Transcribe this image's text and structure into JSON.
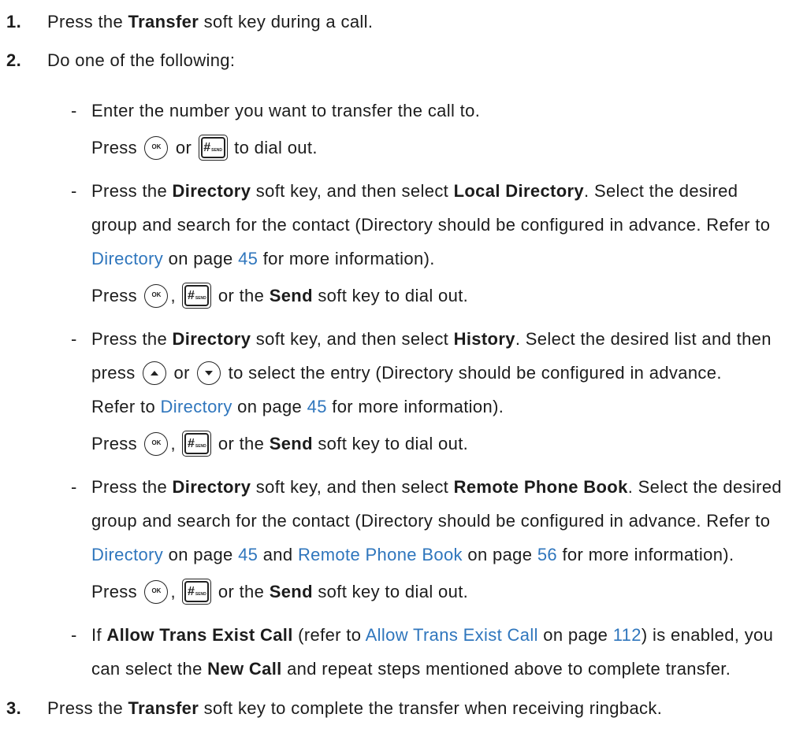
{
  "colors": {
    "text": "#1c1c1c",
    "link": "#2f76bd"
  },
  "keys": {
    "ok": "OK",
    "hash": "#",
    "send": "SEND"
  },
  "steps": [
    {
      "number": "1.",
      "lines": [
        [
          {
            "text": "Press the "
          },
          {
            "bold": "Transfer"
          },
          {
            "text": " soft key during a call."
          }
        ]
      ]
    },
    {
      "number": "2.",
      "lines": [
        [
          {
            "text": "Do one of the following:"
          }
        ]
      ],
      "options": [
        {
          "bullet": "-",
          "lines": [
            [
              {
                "text": "Enter the number you want to transfer the call to."
              }
            ]
          ],
          "press": [
            {
              "text": "Press "
            },
            {
              "key": "ok-key"
            },
            {
              "text": " or "
            },
            {
              "key": "send-key"
            },
            {
              "text": " to dial out."
            }
          ]
        },
        {
          "bullet": "-",
          "lines": [
            [
              {
                "text": "Press the "
              },
              {
                "bold": "Directory"
              },
              {
                "text": " soft key, and then select "
              },
              {
                "bold": "Local Directory"
              },
              {
                "text": ". Select the desired"
              }
            ],
            [
              {
                "text": "group and search for the contact (Directory should be configured in advance. Refer to"
              }
            ],
            [
              {
                "link": "Directory"
              },
              {
                "text": " on page "
              },
              {
                "link": "45"
              },
              {
                "text": " for more information)."
              }
            ]
          ],
          "press": [
            {
              "text": "Press "
            },
            {
              "key": "ok-key"
            },
            {
              "text": ", "
            },
            {
              "key": "send-key"
            },
            {
              "text": " or the "
            },
            {
              "bold": "Send"
            },
            {
              "text": " soft key to dial out."
            }
          ]
        },
        {
          "bullet": "-",
          "lines": [
            [
              {
                "text": "Press the "
              },
              {
                "bold": "Directory"
              },
              {
                "text": " soft key, and then select "
              },
              {
                "bold": "History"
              },
              {
                "text": ". Select the desired list and then"
              }
            ],
            [
              {
                "text": "press "
              },
              {
                "key": "up-key"
              },
              {
                "text": " or "
              },
              {
                "key": "down-key"
              },
              {
                "text": " to select the entry (Directory should be configured in advance."
              }
            ],
            [
              {
                "text": "Refer to "
              },
              {
                "link": "Directory"
              },
              {
                "text": " on page "
              },
              {
                "link": "45"
              },
              {
                "text": " for more information)."
              }
            ]
          ],
          "press": [
            {
              "text": "Press "
            },
            {
              "key": "ok-key"
            },
            {
              "text": ", "
            },
            {
              "key": "send-key"
            },
            {
              "text": " or the "
            },
            {
              "bold": "Send"
            },
            {
              "text": " soft key to dial out."
            }
          ]
        },
        {
          "bullet": "-",
          "lines": [
            [
              {
                "text": "Press the "
              },
              {
                "bold": "Directory"
              },
              {
                "text": " soft key, and then select "
              },
              {
                "bold": "Remote Phone Book"
              },
              {
                "text": ". Select the desired"
              }
            ],
            [
              {
                "text": "group and search for the contact (Directory should be configured in advance. Refer to"
              }
            ],
            [
              {
                "link": "Directory"
              },
              {
                "text": " on page "
              },
              {
                "link": "45"
              },
              {
                "text": " and "
              },
              {
                "link": "Remote Phone Book"
              },
              {
                "text": " on page "
              },
              {
                "link": "56"
              },
              {
                "text": " for more information)."
              }
            ]
          ],
          "press": [
            {
              "text": "Press "
            },
            {
              "key": "ok-key"
            },
            {
              "text": ", "
            },
            {
              "key": "send-key"
            },
            {
              "text": " or the "
            },
            {
              "bold": "Send"
            },
            {
              "text": " soft key to dial out."
            }
          ]
        },
        {
          "bullet": "-",
          "lines": [
            [
              {
                "text": "If "
              },
              {
                "bold": "Allow Trans Exist Call"
              },
              {
                "text": " (refer to "
              },
              {
                "link": "Allow Trans Exist Call"
              },
              {
                "text": " on page "
              },
              {
                "link": "112"
              },
              {
                "text": ") is enabled, you"
              }
            ],
            [
              {
                "text": "can select the "
              },
              {
                "bold": "New Call"
              },
              {
                "text": " and repeat steps mentioned above to complete transfer."
              }
            ]
          ]
        }
      ]
    },
    {
      "number": "3.",
      "lines": [
        [
          {
            "text": "Press the "
          },
          {
            "bold": "Transfer"
          },
          {
            "text": " soft key to complete the transfer when receiving ringback."
          }
        ]
      ]
    }
  ]
}
